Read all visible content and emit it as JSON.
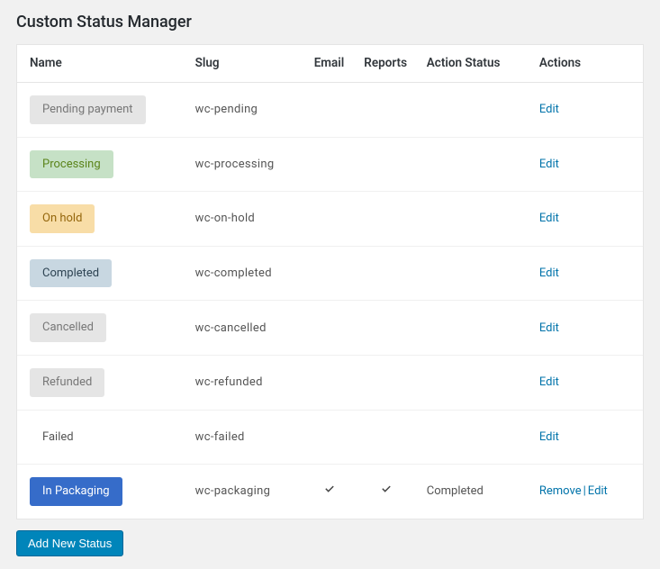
{
  "page": {
    "title": "Custom Status Manager"
  },
  "table": {
    "headers": {
      "name": "Name",
      "slug": "Slug",
      "email": "Email",
      "reports": "Reports",
      "action_status": "Action Status",
      "actions": "Actions"
    },
    "rows": [
      {
        "label": "Pending payment",
        "slug": "wc-pending",
        "email": false,
        "reports": false,
        "action_status": "",
        "actions": [
          "edit"
        ],
        "style": "sb-pending"
      },
      {
        "label": "Processing",
        "slug": "wc-processing",
        "email": false,
        "reports": false,
        "action_status": "",
        "actions": [
          "edit"
        ],
        "style": "sb-processing"
      },
      {
        "label": "On hold",
        "slug": "wc-on-hold",
        "email": false,
        "reports": false,
        "action_status": "",
        "actions": [
          "edit"
        ],
        "style": "sb-onhold"
      },
      {
        "label": "Completed",
        "slug": "wc-completed",
        "email": false,
        "reports": false,
        "action_status": "",
        "actions": [
          "edit"
        ],
        "style": "sb-completed"
      },
      {
        "label": "Cancelled",
        "slug": "wc-cancelled",
        "email": false,
        "reports": false,
        "action_status": "",
        "actions": [
          "edit"
        ],
        "style": "sb-cancelled"
      },
      {
        "label": "Refunded",
        "slug": "wc-refunded",
        "email": false,
        "reports": false,
        "action_status": "",
        "actions": [
          "edit"
        ],
        "style": "sb-refunded"
      },
      {
        "label": "Failed",
        "slug": "wc-failed",
        "email": false,
        "reports": false,
        "action_status": "",
        "actions": [
          "edit"
        ],
        "style": "sb-failed"
      },
      {
        "label": "In Packaging",
        "slug": "wc-packaging",
        "email": true,
        "reports": true,
        "action_status": "Completed",
        "actions": [
          "remove",
          "edit"
        ],
        "style": "sb-packaging"
      }
    ],
    "action_labels": {
      "edit": "Edit",
      "remove": "Remove"
    }
  },
  "footer": {
    "add_button": "Add New Status"
  }
}
